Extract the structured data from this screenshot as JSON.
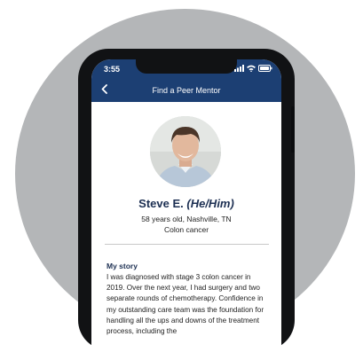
{
  "status_bar": {
    "time": "3:55"
  },
  "nav": {
    "back_icon": "chevron-left-icon",
    "title": "Find a Peer Mentor"
  },
  "profile": {
    "name": "Steve E.",
    "pronouns": "(He/Him)",
    "details_line1": "58 years old, Nashville, TN",
    "details_line2": "Colon cancer"
  },
  "story": {
    "heading": "My story",
    "text": "I was diagnosed with stage 3 colon cancer in 2019. Over the next year, I had surgery and two separate rounds of chemotherapy. Confidence in my outstanding care team was the foundation for handling all the ups and downs of the treatment process, including the"
  },
  "colors": {
    "nav_bg": "#1c3f73",
    "accent": "#1c2f52",
    "backdrop": "#b4b6b8"
  }
}
